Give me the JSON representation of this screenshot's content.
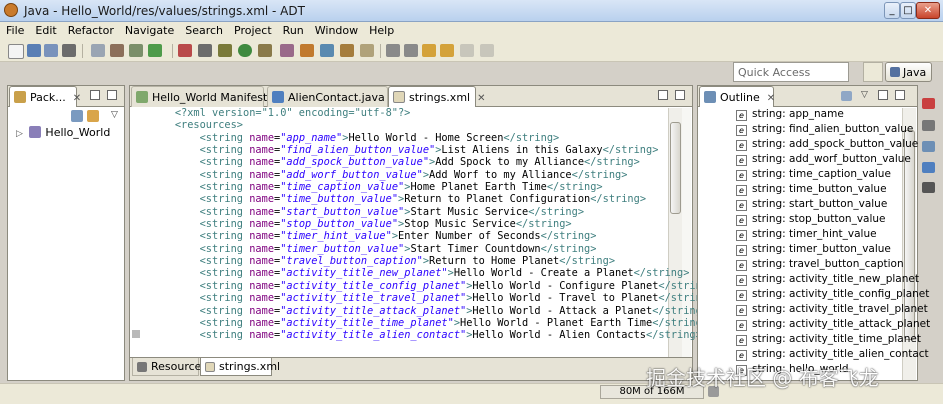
{
  "window": {
    "title": "Java - Hello_World/res/values/strings.xml - ADT",
    "minimize": "_",
    "maximize": "□",
    "close": "✕"
  },
  "menu": [
    "File",
    "Edit",
    "Refactor",
    "Navigate",
    "Search",
    "Project",
    "Run",
    "Window",
    "Help"
  ],
  "toolbar": {
    "quick_access_placeholder": "Quick Access",
    "perspective_label": "Java"
  },
  "package_explorer": {
    "tab_label": "Pack...",
    "tree": [
      {
        "label": "Hello_World",
        "expander": "▷"
      }
    ]
  },
  "editor": {
    "tabs": [
      {
        "label": "Hello_World Manifest",
        "active": false
      },
      {
        "label": "AlienContact.java",
        "active": false
      },
      {
        "label": "strings.xml",
        "active": true
      }
    ],
    "code_lines": [
      {
        "indent": "    ",
        "kind": "pi",
        "text": "<?xml version=\"1.0\" encoding=\"utf-8\"?>"
      },
      {
        "indent": "    ",
        "kind": "open",
        "text": "<resources>"
      },
      {
        "indent": "        ",
        "name": "app_name",
        "value": "Hello World - Home Screen"
      },
      {
        "indent": "        ",
        "name": "find_alien_button_value",
        "value": "List Aliens in this Galaxy"
      },
      {
        "indent": "        ",
        "name": "add_spock_button_value",
        "value": "Add Spock to my Alliance"
      },
      {
        "indent": "        ",
        "name": "add_worf_button_value",
        "value": "Add Worf to my Alliance"
      },
      {
        "indent": "        ",
        "name": "time_caption_value",
        "value": "Home Planet Earth Time"
      },
      {
        "indent": "        ",
        "name": "time_button_value",
        "value": "Return to Planet Configuration"
      },
      {
        "indent": "        ",
        "name": "start_button_value",
        "value": "Start Music Service"
      },
      {
        "indent": "        ",
        "name": "stop_button_value",
        "value": "Stop Music Service"
      },
      {
        "indent": "        ",
        "name": "timer_hint_value",
        "value": "Enter Number of Seconds"
      },
      {
        "indent": "        ",
        "name": "timer_button_value",
        "value": "Start Timer Countdown"
      },
      {
        "indent": "        ",
        "name": "travel_button_caption",
        "value": "Return to Home Planet"
      },
      {
        "indent": "        ",
        "name": "activity_title_new_planet",
        "value": "Hello World - Create a Planet"
      },
      {
        "indent": "        ",
        "name": "activity_title_config_planet",
        "value": "Hello World - Configure Planet"
      },
      {
        "indent": "        ",
        "name": "activity_title_travel_planet",
        "value": "Hello World - Travel to Planet"
      },
      {
        "indent": "        ",
        "name": "activity_title_attack_planet",
        "value": "Hello World - Attack a Planet"
      },
      {
        "indent": "        ",
        "name": "activity_title_time_planet",
        "value": "Hello World - Planet Earth Time"
      },
      {
        "indent": "        ",
        "name": "activity_title_alien_contact",
        "value": "Hello World - Alien Contacts"
      }
    ],
    "bottom_tabs": [
      "Resources",
      "strings.xml"
    ]
  },
  "outline": {
    "tab_label": "Outline",
    "icon_letter": "e",
    "items": [
      "string: app_name",
      "string: find_alien_button_value",
      "string: add_spock_button_value",
      "string: add_worf_button_value",
      "string: time_caption_value",
      "string: time_button_value",
      "string: start_button_value",
      "string: stop_button_value",
      "string: timer_hint_value",
      "string: timer_button_value",
      "string: travel_button_caption",
      "string: activity_title_new_planet",
      "string: activity_title_config_planet",
      "string: activity_title_travel_planet",
      "string: activity_title_attack_planet",
      "string: activity_title_time_planet",
      "string: activity_title_alien_contact",
      "string: hello_world"
    ]
  },
  "status": {
    "memory": "80M of 166M"
  },
  "watermark": "掘金技术社区 @ 布客飞龙",
  "colors": {
    "tag": "#3f7f7f",
    "attribute": "#7f007f",
    "value": "#2a00ff",
    "titlebar": "#b9d1ee",
    "chrome": "#ece9d8"
  }
}
